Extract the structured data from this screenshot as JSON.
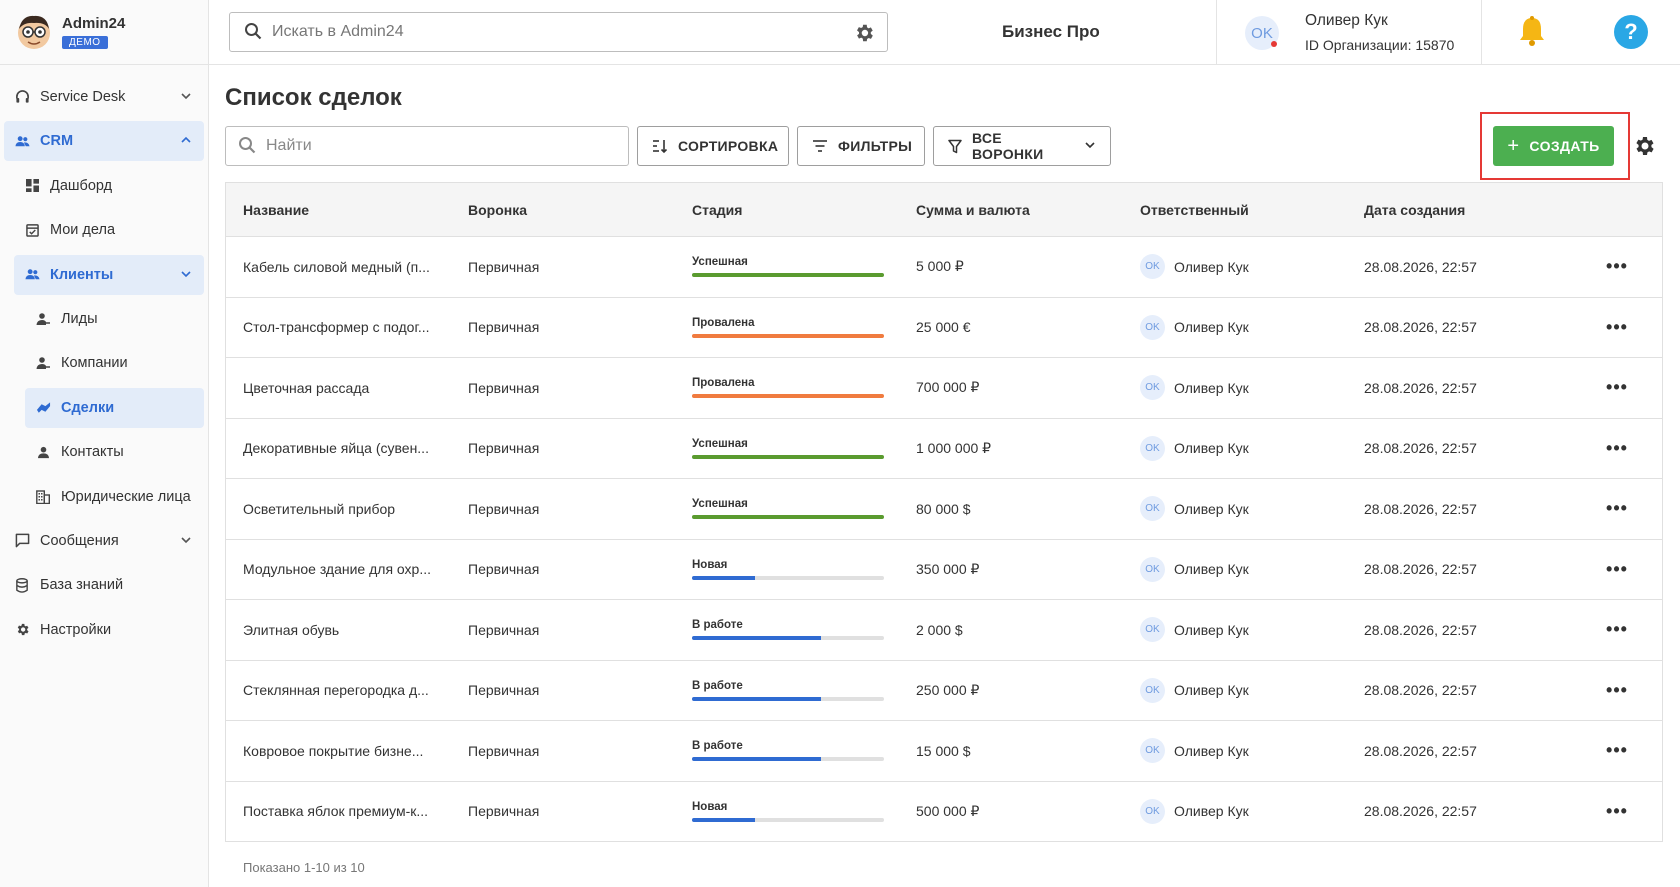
{
  "brand": {
    "name": "Admin24",
    "badge": "ДЕМО"
  },
  "sidebar": {
    "items": [
      {
        "label": "Service Desk"
      },
      {
        "label": "CRM"
      },
      {
        "label": "Дашборд"
      },
      {
        "label": "Мои дела"
      },
      {
        "label": "Клиенты"
      },
      {
        "label": "Лиды"
      },
      {
        "label": "Компании"
      },
      {
        "label": "Сделки"
      },
      {
        "label": "Контакты"
      },
      {
        "label": "Юридические лица"
      },
      {
        "label": "Сообщения"
      },
      {
        "label": "База знаний"
      },
      {
        "label": "Настройки"
      }
    ]
  },
  "topbar": {
    "search_placeholder": "Искать в Admin24",
    "org_name": "Бизнес Про",
    "user_initials": "OK",
    "user_name": "Оливер Кук",
    "org_id": "ID Организации: 15870",
    "help": "?"
  },
  "main": {
    "title": "Список сделок",
    "search_placeholder": "Найти",
    "sort_label": "СОРТИРОВКА",
    "filter_label": "ФИЛЬТРЫ",
    "funnels_label": "ВСЕ ВОРОНКИ",
    "create_label": "СОЗДАТЬ"
  },
  "table": {
    "headers": [
      "Название",
      "Воронка",
      "Стадия",
      "Сумма и валюта",
      "Ответственный",
      "Дата создания"
    ],
    "rows": [
      {
        "name": "Кабель силовой медный (п...",
        "funnel": "Первичная",
        "stage": "Успешная",
        "progress": 1.0,
        "color": "#5a9b2f",
        "amount": "5 000 ₽",
        "initials": "OK",
        "resp": "Оливер Кук",
        "date": "28.08.2026, 22:57"
      },
      {
        "name": "Стол-трансформер с подог...",
        "funnel": "Первичная",
        "stage": "Провалена",
        "progress": 1.0,
        "color": "#f07b3f",
        "amount": "25 000 €",
        "initials": "OK",
        "resp": "Оливер Кук",
        "date": "28.08.2026, 22:57"
      },
      {
        "name": "Цветочная рассада",
        "funnel": "Первичная",
        "stage": "Провалена",
        "progress": 1.0,
        "color": "#f07b3f",
        "amount": "700 000 ₽",
        "initials": "OK",
        "resp": "Оливер Кук",
        "date": "28.08.2026, 22:57"
      },
      {
        "name": "Декоративные яйца (сувен...",
        "funnel": "Первичная",
        "stage": "Успешная",
        "progress": 1.0,
        "color": "#5a9b2f",
        "amount": "1 000 000 ₽",
        "initials": "OK",
        "resp": "Оливер Кук",
        "date": "28.08.2026, 22:57"
      },
      {
        "name": "Осветительный прибор",
        "funnel": "Первичная",
        "stage": "Успешная",
        "progress": 1.0,
        "color": "#5a9b2f",
        "amount": "80 000 $",
        "initials": "OK",
        "resp": "Оливер Кук",
        "date": "28.08.2026, 22:57"
      },
      {
        "name": "Модульное здание для охр...",
        "funnel": "Первичная",
        "stage": "Новая",
        "progress": 0.33,
        "color": "#2f6bd2",
        "amount": "350 000 ₽",
        "initials": "OK",
        "resp": "Оливер Кук",
        "date": "28.08.2026, 22:57"
      },
      {
        "name": "Элитная обувь",
        "funnel": "Первичная",
        "stage": "В работе",
        "progress": 0.67,
        "color": "#2f6bd2",
        "amount": "2 000 $",
        "initials": "OK",
        "resp": "Оливер Кук",
        "date": "28.08.2026, 22:57"
      },
      {
        "name": "Стеклянная перегородка д...",
        "funnel": "Первичная",
        "stage": "В работе",
        "progress": 0.67,
        "color": "#2f6bd2",
        "amount": "250 000 ₽",
        "initials": "OK",
        "resp": "Оливер Кук",
        "date": "28.08.2026, 22:57"
      },
      {
        "name": "Ковровое покрытие бизне...",
        "funnel": "Первичная",
        "stage": "В работе",
        "progress": 0.67,
        "color": "#2f6bd2",
        "amount": "15 000 $",
        "initials": "OK",
        "resp": "Оливер Кук",
        "date": "28.08.2026, 22:57"
      },
      {
        "name": "Поставка яблок премиум-к...",
        "funnel": "Первичная",
        "stage": "Новая",
        "progress": 0.33,
        "color": "#2f6bd2",
        "amount": "500 000 ₽",
        "initials": "OK",
        "resp": "Оливер Кук",
        "date": "28.08.2026, 22:57"
      }
    ],
    "footer": "Показано 1-10 из 10"
  },
  "colors": {
    "accent": "#2f6bd2",
    "create": "#4caf50",
    "highlight": "#e53935"
  }
}
